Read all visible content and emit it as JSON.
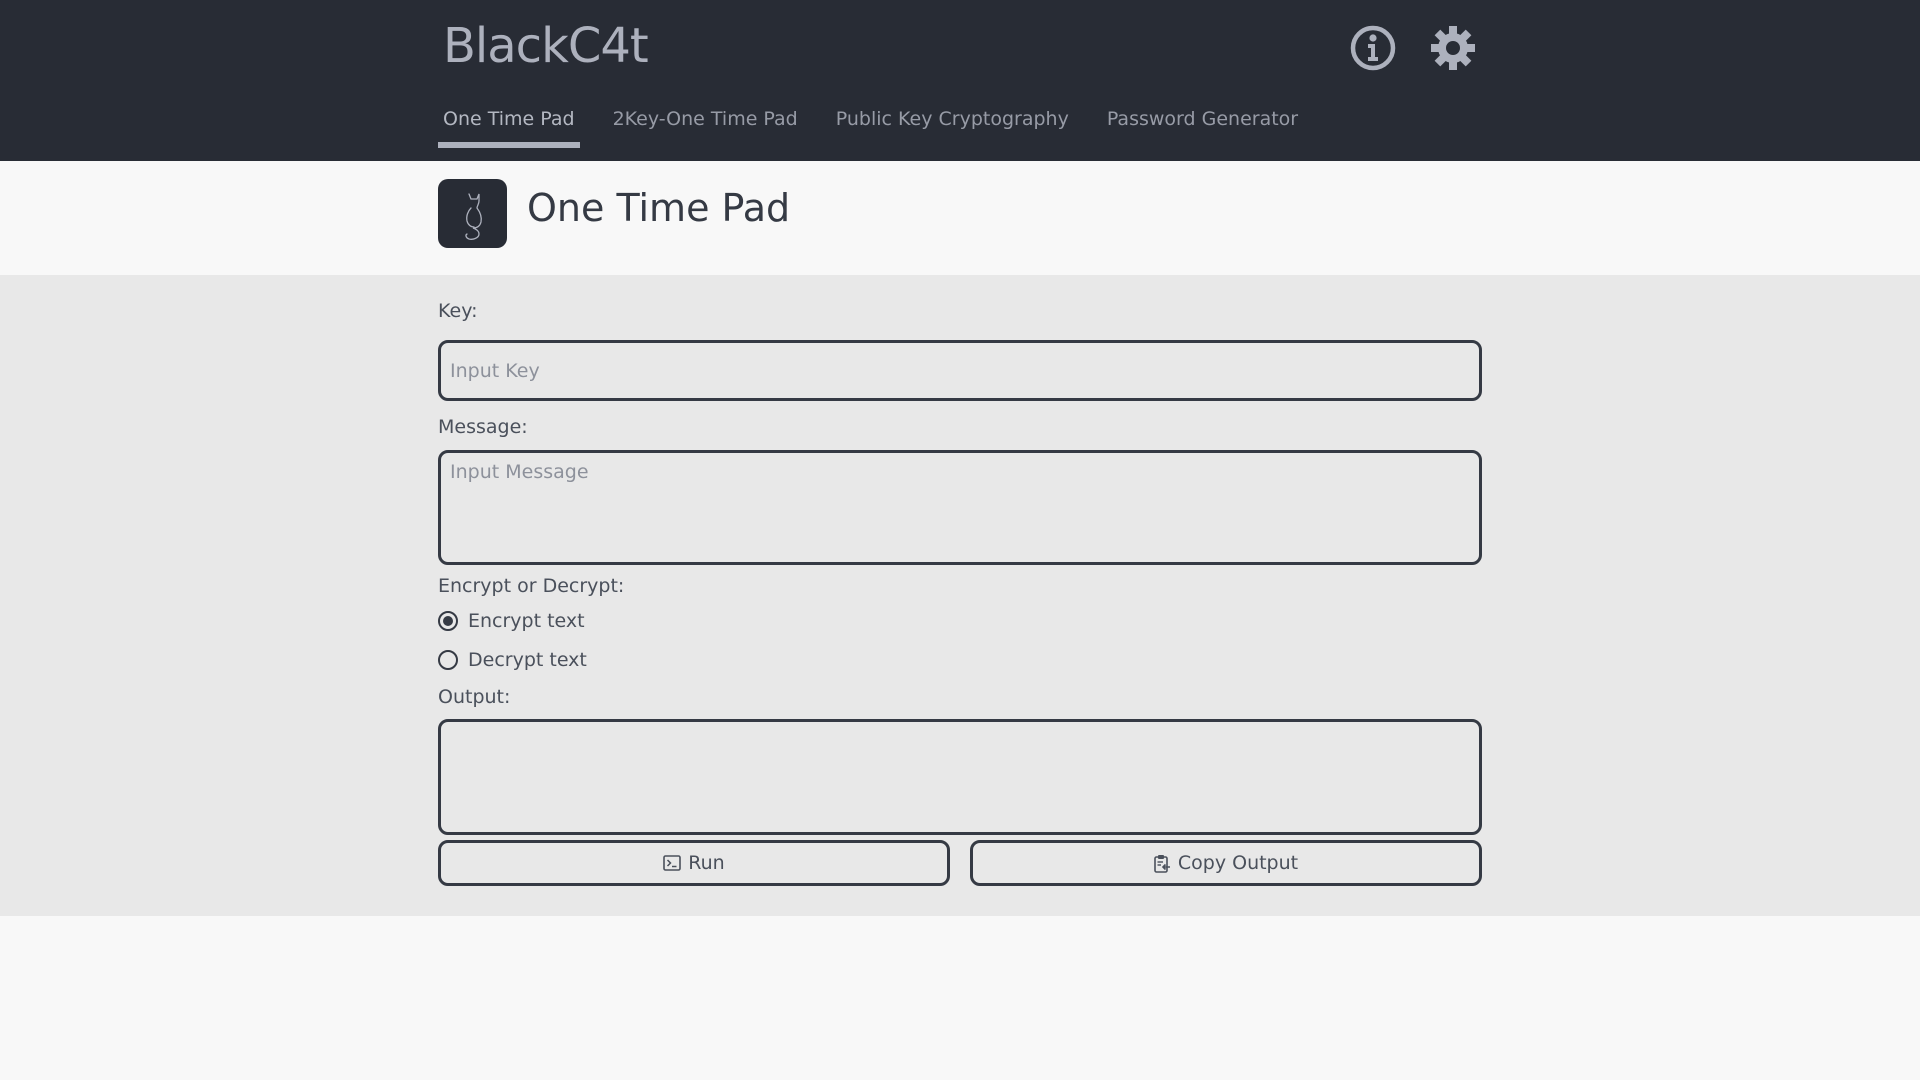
{
  "header": {
    "brand": "BlackC4t",
    "icons": [
      "info-icon",
      "gear-icon"
    ],
    "tabs": [
      {
        "label": "One Time Pad",
        "active": true
      },
      {
        "label": "2Key-One Time Pad",
        "active": false
      },
      {
        "label": "Public Key Cryptography",
        "active": false
      },
      {
        "label": "Password Generator",
        "active": false
      }
    ]
  },
  "page": {
    "title": "One Time Pad",
    "logo_icon": "cat-icon"
  },
  "form": {
    "key_label": "Key:",
    "key_placeholder": "Input Key",
    "key_value": "",
    "message_label": "Message:",
    "message_placeholder": "Input Message",
    "message_value": "",
    "mode_label": "Encrypt or Decrypt:",
    "modes": [
      {
        "label": "Encrypt text",
        "selected": true
      },
      {
        "label": "Decrypt text",
        "selected": false
      }
    ],
    "output_label": "Output:",
    "output_value": "",
    "run_label": "Run",
    "copy_label": "Copy Output"
  },
  "colors": {
    "header_bg": "#282c35",
    "accent": "#adb1bd",
    "form_bg": "#e8e8e8",
    "border": "#353a44"
  }
}
